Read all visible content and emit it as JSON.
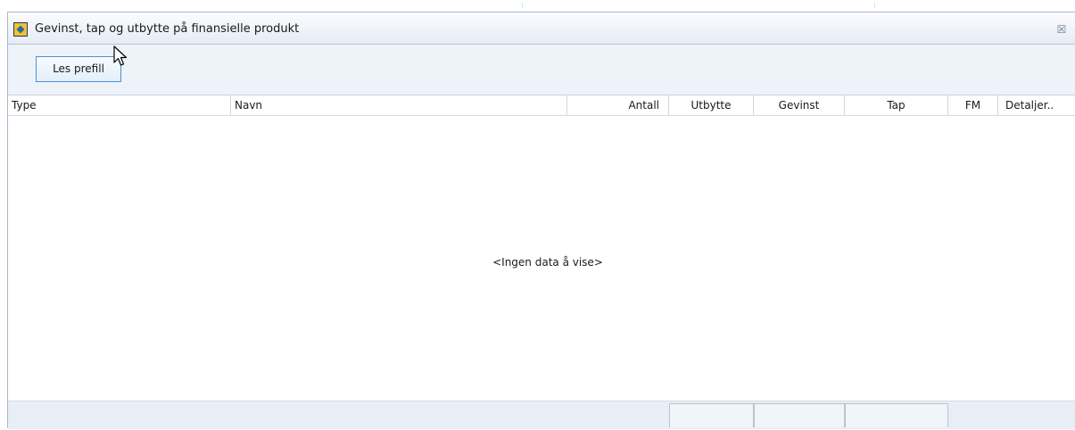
{
  "window": {
    "title": "Gevinst, tap og utbytte på finansielle produkt",
    "icon": "form-icon",
    "close_label": "☒"
  },
  "toolbar": {
    "les_prefill_label": "Les prefill"
  },
  "grid": {
    "columns": [
      "Type",
      "Navn",
      "Antall",
      "Utbytte",
      "Gevinst",
      "Tap",
      "FM",
      "Detaljer.."
    ],
    "empty_message": "<Ingen data å vise>"
  },
  "colors": {
    "panel_border": "#a9b9cc",
    "button_border": "#4a90d9",
    "background": "#eef3f9"
  }
}
